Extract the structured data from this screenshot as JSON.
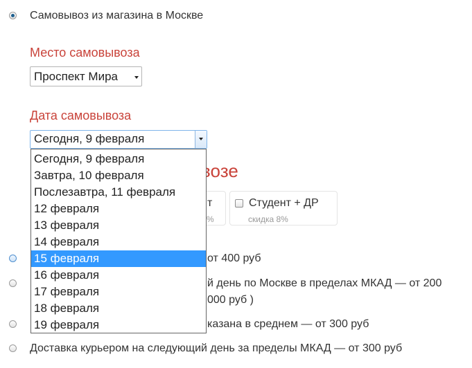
{
  "pickup_moscow": {
    "label": "Самовывоз из магазина в Москве"
  },
  "pickup_place": {
    "label": "Место самовывоза",
    "selected": "Проспект Мира"
  },
  "pickup_date": {
    "label": "Дата самовывоза",
    "selected": "Сегодня, 9 февраля",
    "options": [
      "Сегодня, 9 февраля",
      "Завтра, 10 февраля",
      "Послезавтра, 11 февраля",
      "12 февраля",
      "13 февраля",
      "14 февраля",
      "15 февраля",
      "16 февраля",
      "17 февраля",
      "18 февраля",
      "19 февраля"
    ],
    "highlighted": "15 февраля"
  },
  "partial_heading": "возе",
  "discounts": [
    {
      "label": "т",
      "note": "%"
    },
    {
      "label": "Студент + ДР",
      "note": "скидка 8%"
    }
  ],
  "delivery_options": [
    {
      "text": "от 400 руб"
    },
    {
      "text": "й день по Москве в пределах МКАД — от 200",
      "text2": "000 руб )"
    },
    {
      "text": "казана в среднем — от 300 руб"
    },
    {
      "text": "Доставка курьером на следующий день за пределы МКАД — от 300 руб"
    }
  ],
  "colors": {
    "section_label": "#c9433a",
    "highlight": "#3399ff"
  }
}
